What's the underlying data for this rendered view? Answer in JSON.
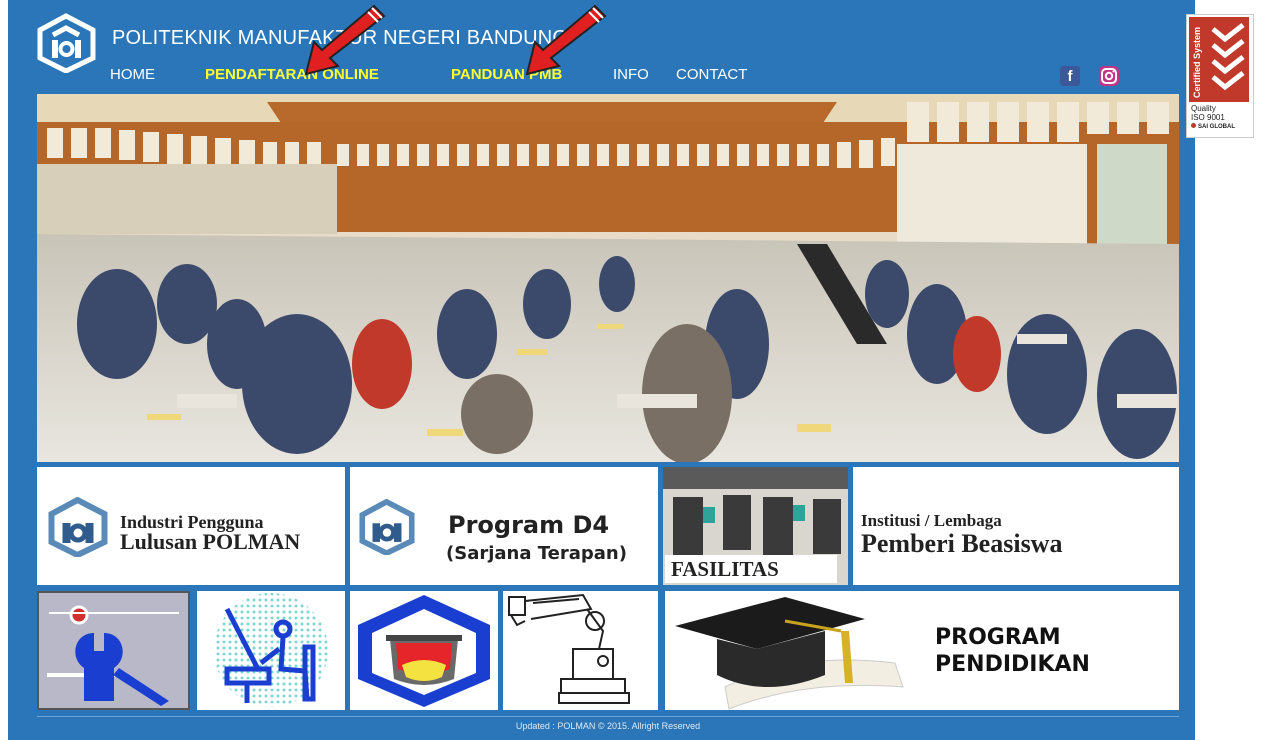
{
  "header": {
    "site_title": "POLITEKNIK MANUFAKTUR NEGERI BANDUNG"
  },
  "nav": [
    {
      "label": "HOME"
    },
    {
      "label": "PENDAFTARAN ONLINE"
    },
    {
      "label": "PANDUAN PMB"
    },
    {
      "label": "INFO"
    },
    {
      "label": "CONTACT"
    }
  ],
  "social": {
    "facebook": "f",
    "facebook_icon": "facebook-icon",
    "instagram_icon": "instagram-icon"
  },
  "tiles_row1": [
    {
      "line1": "Industri Pengguna",
      "line2": "Lulusan POLMAN"
    },
    {
      "line1": "Program D4",
      "line2": "(Sarjana Terapan)"
    },
    {
      "label": "FASILITAS"
    },
    {
      "line1": "Institusi / Lembaga",
      "line2": "Pemberi Beasiswa"
    }
  ],
  "tiles_row2": [
    {
      "icon": "wrench-icon"
    },
    {
      "icon": "drafting-icon"
    },
    {
      "icon": "foundry-ladle-icon"
    },
    {
      "icon": "robot-arm-icon"
    },
    {
      "line1": "PROGRAM",
      "line2": "PENDIDIKAN"
    }
  ],
  "footer": {
    "text": "Updated : POLMAN © 2015. Allright Reserved"
  },
  "iso_badge": {
    "vertical": "Certified System",
    "line1": "Quality",
    "line2": "ISO 9001",
    "line3": "SAI GLOBAL"
  },
  "colors": {
    "background": "#2a76b8",
    "nav_highlight": "#ffff33",
    "arrow": "#e02020"
  }
}
